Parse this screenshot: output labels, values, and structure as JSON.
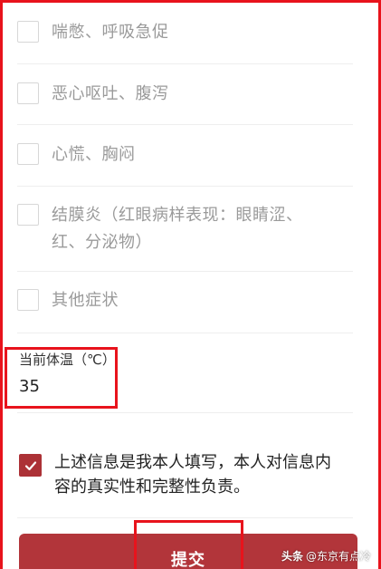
{
  "symptoms": [
    {
      "label": "喘憋、呼吸急促",
      "checked": false
    },
    {
      "label": "恶心呕吐、腹泻",
      "checked": false
    },
    {
      "label": "心慌、胸闷",
      "checked": false
    },
    {
      "label": "结膜炎（红眼病样表现：眼睛涩、红、分泌物）",
      "checked": false
    },
    {
      "label": "其他症状",
      "checked": false
    }
  ],
  "temperature": {
    "label": "当前体温（℃）",
    "value": "35"
  },
  "agreement": {
    "checked": true,
    "text": "上述信息是我本人填写，本人对信息内容的真实性和完整性负责。"
  },
  "submit": {
    "label": "提交"
  },
  "watermark": {
    "prefix": "头条",
    "author": "@东京有点冷"
  },
  "colors": {
    "accent": "#b2353a",
    "highlight": "#e8131c",
    "muted_text": "#9a9a9a"
  }
}
